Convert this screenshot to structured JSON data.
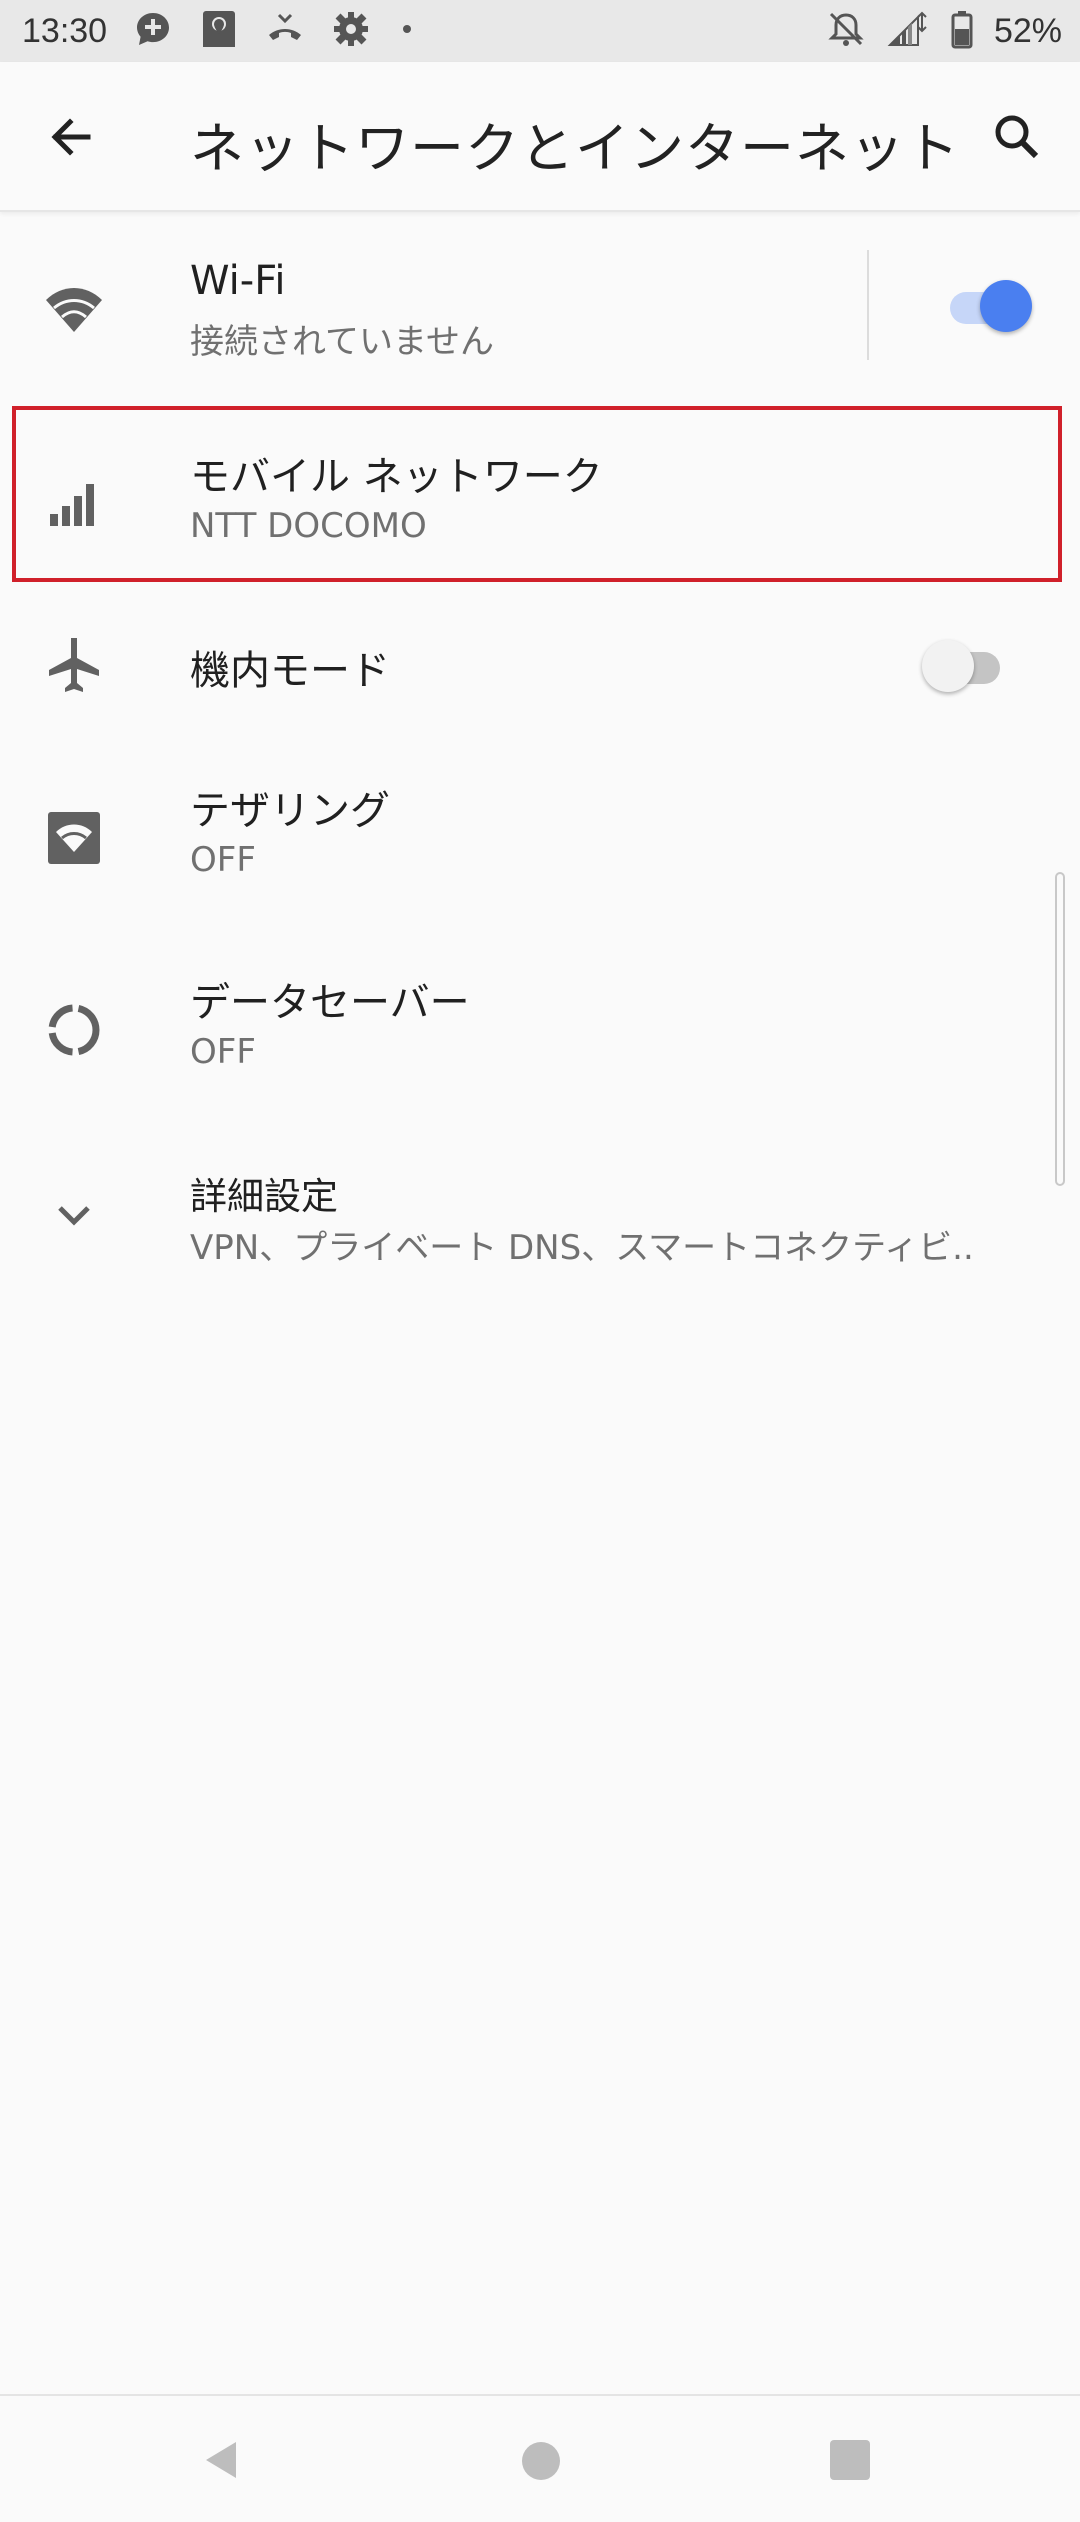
{
  "status_bar": {
    "time": "13:30",
    "left_icons": [
      "chat-bubble-add-icon",
      "map-pin-icon",
      "phone-hangup-icon",
      "settings-icon",
      "dot-icon"
    ],
    "right_icons": [
      "notifications-off-icon",
      "signal-icon",
      "battery-icon"
    ],
    "battery": "52%"
  },
  "app_bar": {
    "title": "ネットワークとインターネット",
    "icons": [
      "back-arrow-icon",
      "search-icon"
    ]
  },
  "items": [
    {
      "title": "Wi-Fi",
      "subtitle": "接続されていません",
      "icon": "wifi-icon",
      "toggle": "on"
    },
    {
      "title": "モバイル ネットワーク",
      "subtitle": "NTT DOCOMO",
      "icon": "cell-signal-icon",
      "highlighted": true
    },
    {
      "title": "機内モード",
      "icon": "airplane-icon",
      "toggle": "off"
    },
    {
      "title": "テザリング",
      "subtitle": "OFF",
      "icon": "hotspot-icon"
    },
    {
      "title": "データセーバー",
      "subtitle": "OFF",
      "icon": "data-saver-icon"
    },
    {
      "title": "詳細設定",
      "subtitle": "VPN、プライベート DNS、スマートコネクティビ..",
      "icon": "chevron-down-icon"
    }
  ],
  "colors": {
    "accent": "#4a7ff0",
    "accent_track": "#c6d6f8",
    "highlight_border": "#d0202a",
    "icon_gray": "#616161"
  },
  "nav_bar": {
    "icons": [
      "nav-back-icon",
      "nav-home-icon",
      "nav-recent-icon"
    ]
  }
}
